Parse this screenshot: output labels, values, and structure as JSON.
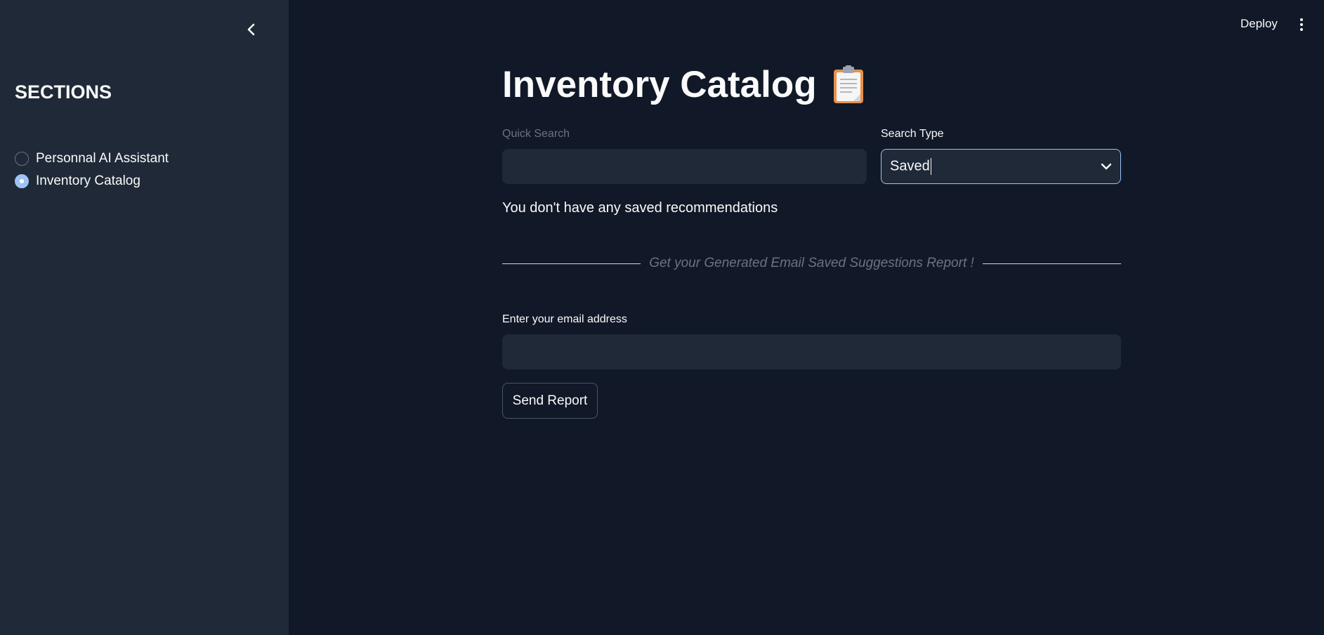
{
  "sidebar": {
    "title": "SECTIONS",
    "collapse_icon": "chevron-left-icon",
    "items": [
      {
        "label": "Personnal AI Assistant",
        "selected": false
      },
      {
        "label": "Inventory Catalog",
        "selected": true
      }
    ]
  },
  "header": {
    "deploy_label": "Deploy",
    "menu_icon": "more-vertical-icon"
  },
  "main": {
    "title": "Inventory Catalog",
    "title_icon": "clipboard-icon",
    "quick_search": {
      "label": "Quick Search",
      "value": ""
    },
    "search_type": {
      "label": "Search Type",
      "value": "Saved"
    },
    "info_text": "You don't have any saved recommendations",
    "divider_text": "Get your Generated Email Saved Suggestions Report !",
    "email": {
      "label": "Enter your email address",
      "value": ""
    },
    "send_button_label": "Send Report"
  },
  "colors": {
    "background": "#111827",
    "sidebar": "#1f2937",
    "accent": "#9cc3f5",
    "muted_text": "#6b7280"
  }
}
